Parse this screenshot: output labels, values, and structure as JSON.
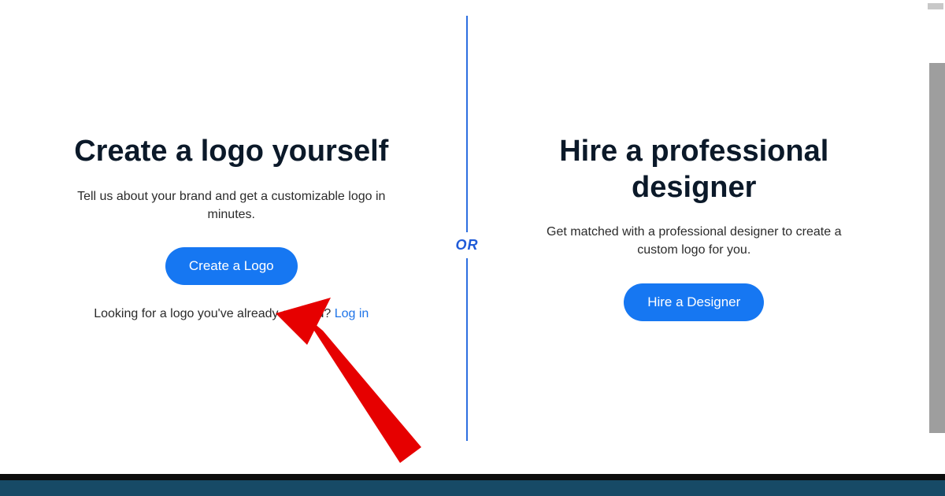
{
  "divider_label": "OR",
  "left": {
    "heading": "Create a logo yourself",
    "subtext": "Tell us about your brand and get a customizable logo in minutes.",
    "button_label": "Create a Logo",
    "lookup_text": "Looking for a logo you've already created? ",
    "lookup_link_label": "Log in"
  },
  "right": {
    "heading": "Hire a professional designer",
    "subtext": "Get matched with a professional designer to create a custom logo for you.",
    "button_label": "Hire a Designer"
  },
  "annotation": {
    "arrow_color": "#e60000",
    "arrow_target": "create-logo-button"
  }
}
